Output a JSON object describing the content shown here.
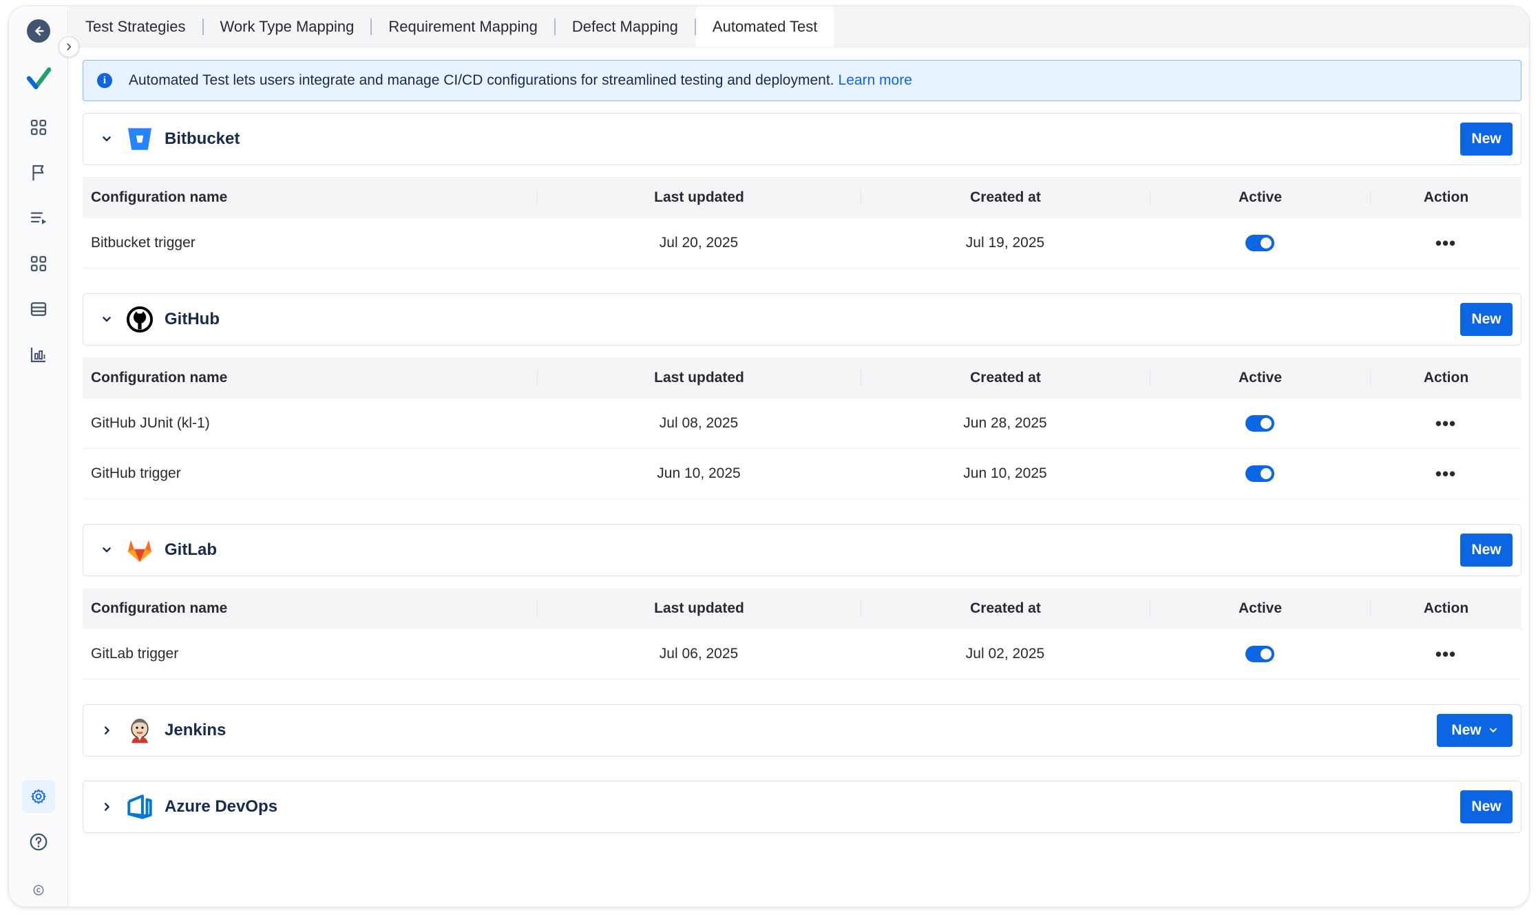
{
  "tabs": [
    {
      "label": "Test Strategies"
    },
    {
      "label": "Work Type Mapping"
    },
    {
      "label": "Requirement Mapping"
    },
    {
      "label": "Defect Mapping"
    },
    {
      "label": "Automated Test",
      "active": true
    }
  ],
  "banner": {
    "text": "Automated Test lets users integrate and manage CI/CD configurations for streamlined testing and deployment.",
    "link": "Learn more"
  },
  "columns": [
    "Configuration name",
    "Last updated",
    "Created at",
    "Active",
    "Action"
  ],
  "sections": [
    {
      "name": "Bitbucket",
      "logo": "bitbucket-icon",
      "expanded": true,
      "button": "New",
      "rows": [
        {
          "name": "Bitbucket trigger",
          "updated": "Jul 20, 2025",
          "created": "Jul 19, 2025",
          "active": true,
          "action": "•••"
        }
      ]
    },
    {
      "name": "GitHub",
      "logo": "github-icon",
      "expanded": true,
      "button": "New",
      "rows": [
        {
          "name": "GitHub JUnit (kl-1)",
          "updated": "Jul 08, 2025",
          "created": "Jun 28, 2025",
          "active": true,
          "action": "•••"
        },
        {
          "name": "GitHub trigger",
          "updated": "Jun 10, 2025",
          "created": "Jun 10, 2025",
          "active": true,
          "action": "•••"
        }
      ]
    },
    {
      "name": "GitLab",
      "logo": "gitlab-icon",
      "expanded": true,
      "button": "New",
      "rows": [
        {
          "name": "GitLab trigger",
          "updated": "Jul 06, 2025",
          "created": "Jul 02, 2025",
          "active": true,
          "action": "•••"
        }
      ]
    },
    {
      "name": "Jenkins",
      "logo": "jenkins-icon",
      "expanded": false,
      "button": "New",
      "button_dropdown": true,
      "rows": []
    },
    {
      "name": "Azure DevOps",
      "logo": "azure-devops-icon",
      "expanded": false,
      "button": "New",
      "rows": []
    }
  ],
  "rail_icons": [
    "back-arrow-icon",
    "check-logo-icon",
    "dashboard-icon",
    "flag-icon",
    "list-run-icon",
    "apps-grid-icon",
    "database-icon",
    "report-chart-icon",
    "settings-icon",
    "help-icon",
    "copyright-icon"
  ],
  "colors": {
    "primary": "#0c66e4",
    "banner_bg": "#e9f2ff",
    "logo_check": "#22a06b"
  }
}
